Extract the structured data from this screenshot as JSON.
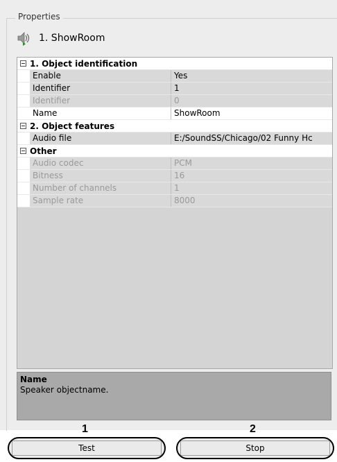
{
  "panel": {
    "legend": "Properties"
  },
  "object": {
    "title": "1. ShowRoom",
    "icon": "speaker-icon"
  },
  "sections": [
    {
      "label": "1. Object identification"
    },
    {
      "label": "2. Object features"
    },
    {
      "label": "Other"
    }
  ],
  "props": {
    "enable": {
      "name": "Enable",
      "value": "Yes"
    },
    "identifier": {
      "name": "Identifier",
      "value": "1"
    },
    "identifier2": {
      "name": "Identifier",
      "value": "0"
    },
    "name": {
      "name": "Name",
      "value": "ShowRoom"
    },
    "audio_file": {
      "name": "Audio file",
      "value": "E:/SoundSS/Chicago/02 Funny Hc"
    },
    "audio_codec": {
      "name": "Audio codec",
      "value": "PCM"
    },
    "bitness": {
      "name": "Bitness",
      "value": "16"
    },
    "channels": {
      "name": "Number of channels",
      "value": "1"
    },
    "sample_rate": {
      "name": "Sample rate",
      "value": "8000"
    }
  },
  "description": {
    "title": "Name",
    "text": "Speaker objectname."
  },
  "buttons": {
    "test": "Test",
    "stop": "Stop"
  },
  "callouts": {
    "test": "1",
    "stop": "2"
  }
}
